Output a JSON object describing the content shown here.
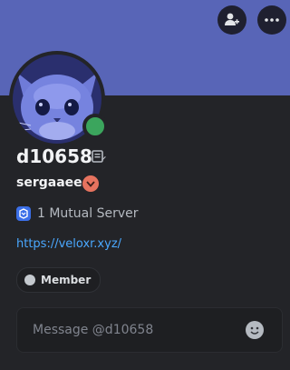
{
  "profile": {
    "display_name": "d10658",
    "username": "sergaaee",
    "status": "online",
    "mutual_servers": "1 Mutual Server",
    "link": "https://veloxr.xyz/",
    "role": "Member"
  },
  "message": {
    "placeholder": "Message @d10658"
  },
  "icons": {
    "add_friend": "add-friend-icon",
    "more": "more-options-icon",
    "note": "note-icon",
    "badge": "profile-badge-icon",
    "server": "server-icon",
    "emoji": "emoji-icon"
  },
  "colors": {
    "banner": "#5865b7",
    "background": "#232428",
    "status_online": "#3ba55d",
    "link": "#4aa8ff",
    "badge": "#e6735f",
    "server_icon": "#3b6fe8"
  }
}
